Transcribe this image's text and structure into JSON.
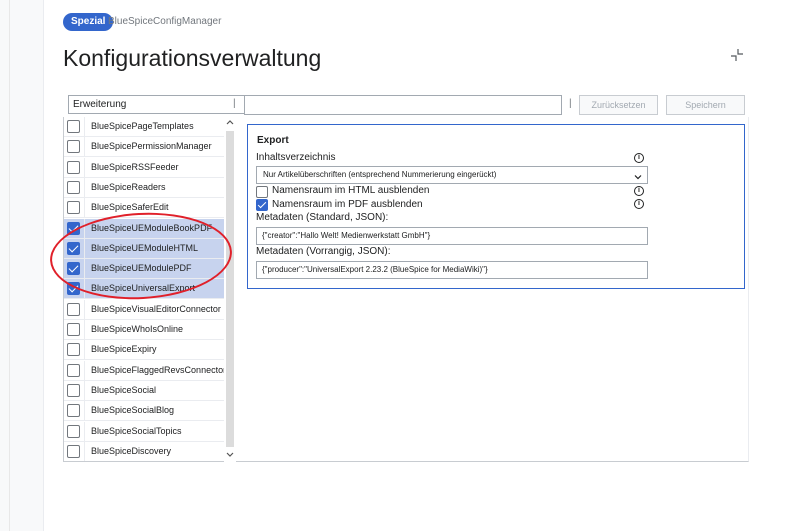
{
  "header": {
    "badge": "Spezial",
    "page_label": "BlueSpiceConfigManager",
    "title": "Konfigurationsverwaltung"
  },
  "toolbar": {
    "filter_select_value": "Erweiterung",
    "search_value": "",
    "reset_label": "Zurücksetzen",
    "save_label": "Speichern",
    "separator": "|"
  },
  "extensions": [
    {
      "label": "BlueSpicePageTemplates",
      "checked": false
    },
    {
      "label": "BlueSpicePermissionManager",
      "checked": false
    },
    {
      "label": "BlueSpiceRSSFeeder",
      "checked": false
    },
    {
      "label": "BlueSpiceReaders",
      "checked": false
    },
    {
      "label": "BlueSpiceSaferEdit",
      "checked": false
    },
    {
      "label": "BlueSpiceUEModuleBookPDF",
      "checked": true
    },
    {
      "label": "BlueSpiceUEModuleHTML",
      "checked": true
    },
    {
      "label": "BlueSpiceUEModulePDF",
      "checked": true
    },
    {
      "label": "BlueSpiceUniversalExport",
      "checked": true
    },
    {
      "label": "BlueSpiceVisualEditorConnector",
      "checked": false
    },
    {
      "label": "BlueSpiceWhoIsOnline",
      "checked": false
    },
    {
      "label": "BlueSpiceExpiry",
      "checked": false
    },
    {
      "label": "BlueSpiceFlaggedRevsConnector",
      "checked": false
    },
    {
      "label": "BlueSpiceSocial",
      "checked": false
    },
    {
      "label": "BlueSpiceSocialBlog",
      "checked": false
    },
    {
      "label": "BlueSpiceSocialTopics",
      "checked": false
    },
    {
      "label": "BlueSpiceDiscovery",
      "checked": false
    }
  ],
  "panel": {
    "heading": "Export",
    "toc_label": "Inhaltsverzeichnis",
    "toc_value": "Nur Artikelüberschriften (entsprechend Nummerierung eingerückt)",
    "hide_ns_html_label": "Namensraum im HTML ausblenden",
    "hide_ns_html_checked": false,
    "hide_ns_pdf_label": "Namensraum im PDF ausblenden",
    "hide_ns_pdf_checked": true,
    "meta_default_label": "Metadaten (Standard, JSON):",
    "meta_default_value": "{\"creator\":\"Hallo Welt! Medienwerkstatt GmbH\"}",
    "meta_override_label": "Metadaten (Vorrangig, JSON):",
    "meta_override_value": "{\"producer\":\"UniversalExport 2.23.2 (BlueSpice for MediaWiki)\"}",
    "info_glyph": "i"
  },
  "colors": {
    "accent": "#3366cc",
    "annotation": "#e0202a",
    "selected_row": "#c7d3ee"
  }
}
